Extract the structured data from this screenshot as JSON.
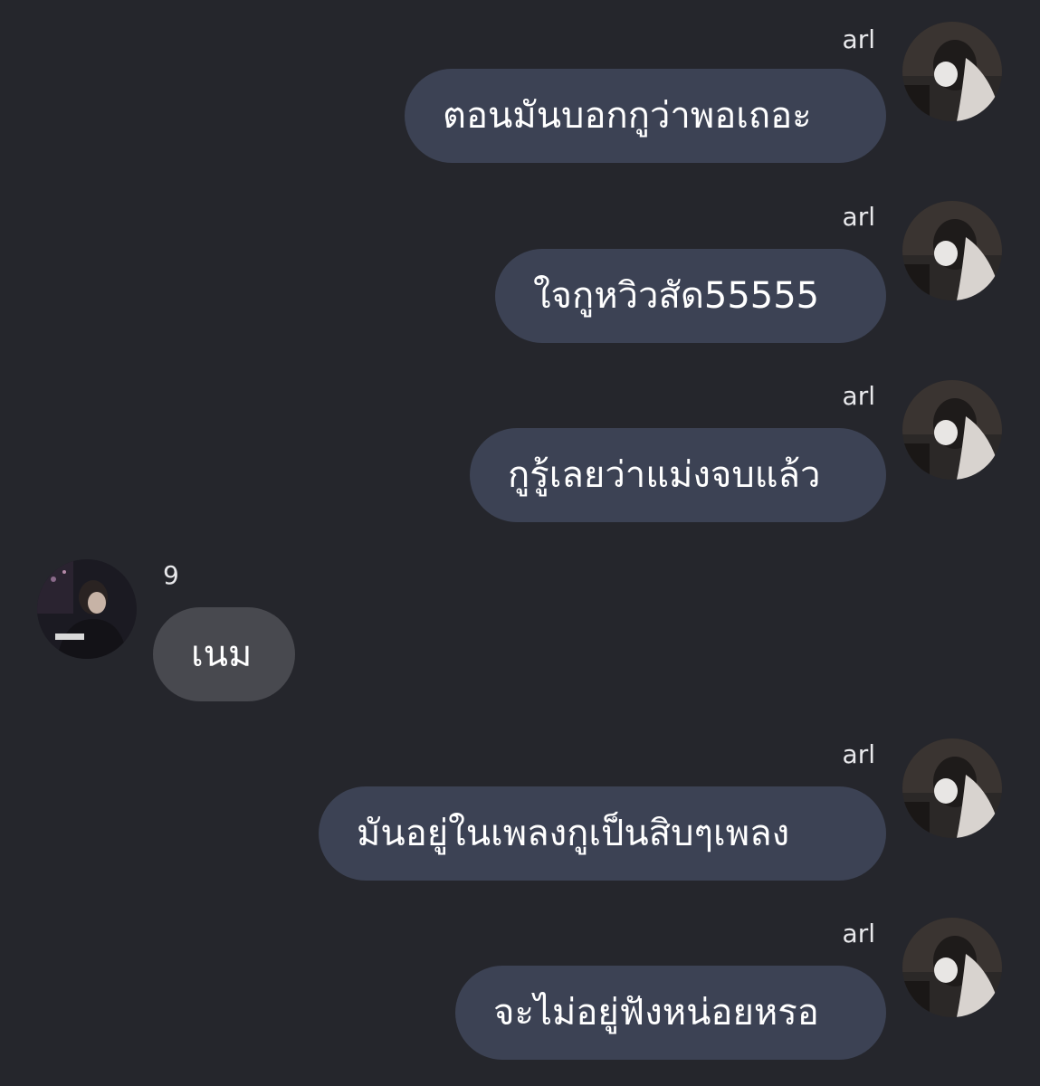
{
  "messages": [
    {
      "sender": "arl",
      "text": "ตอนมันบอกกูว่าพอเถอะ",
      "direction": "out"
    },
    {
      "sender": "arl",
      "text": "ใจกูหวิวสัด55555",
      "direction": "out"
    },
    {
      "sender": "arl",
      "text": "กูรู้เลยว่าแม่งจบแล้ว",
      "direction": "out"
    },
    {
      "sender": "9",
      "text": "เนม",
      "direction": "in"
    },
    {
      "sender": "arl",
      "text": "มันอยู่ในเพลงกูเป็นสิบๆเพลง",
      "direction": "out"
    },
    {
      "sender": "arl",
      "text": "จะไม่อยู่ฟังหน่อยหรอ",
      "direction": "out"
    }
  ],
  "colors": {
    "background": "#25262c",
    "outgoing_bubble": "#3c4254",
    "incoming_bubble": "#48494f",
    "text": "#ffffff"
  },
  "icons": {
    "outgoing_avatar": "avatar-photo-masked-person",
    "incoming_avatar": "avatar-photo-person-dark"
  }
}
